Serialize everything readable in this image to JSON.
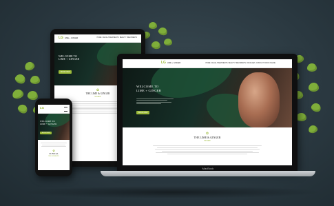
{
  "site": {
    "logo_mark": "LG",
    "logo_name": "LIME + GINGER",
    "nav": [
      "HOME",
      "FACIAL TREATMENTS",
      "BEAUTY TREATMENTS",
      "PACKAGES",
      "CONTACT",
      "BOOK ONLINE"
    ],
    "hero_line1": "WELCOME TO",
    "hero_line2": "LIME + GINGER",
    "hero_button": "BOOK NOW",
    "section_title": "THE LIME & GINGER",
    "section_sub": "STORY",
    "phone_section_title": "CLINICAL",
    "phone_section_sub": "TREATMENTS"
  },
  "device_labels": {
    "laptop_brand": "MacBook"
  },
  "colors": {
    "background": "#2a3840",
    "accent": "#9dbb3a",
    "leaf": "#7fae3a"
  }
}
